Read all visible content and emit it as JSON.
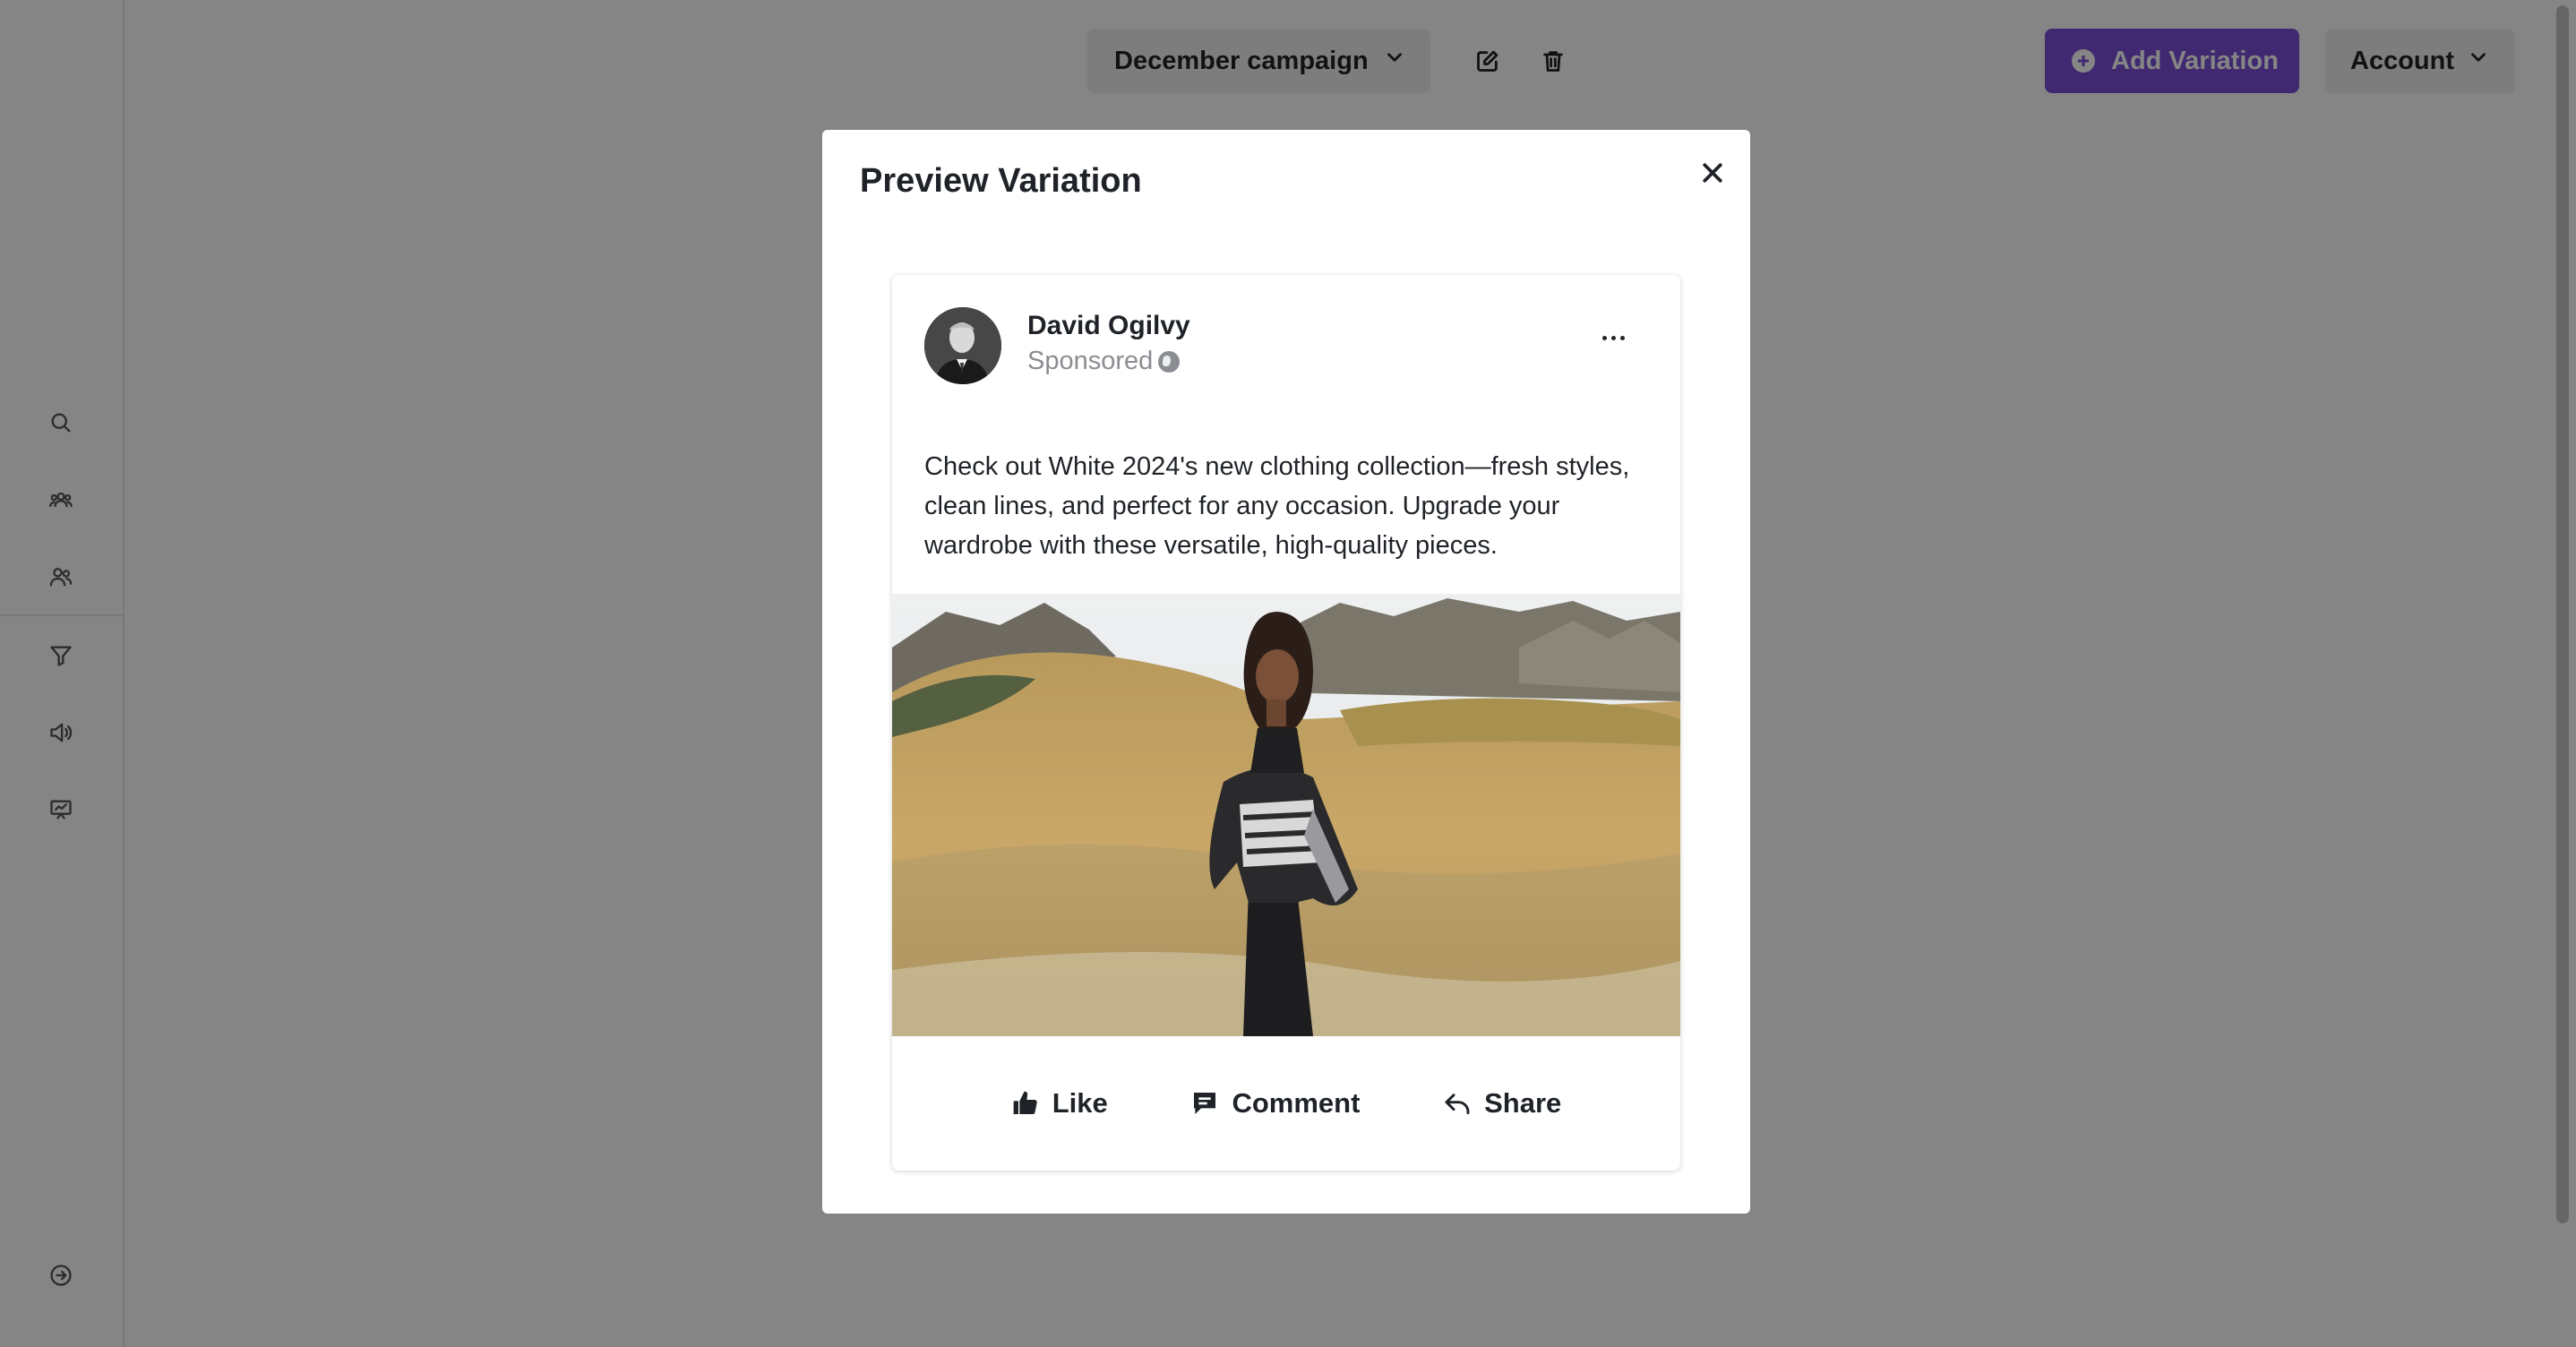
{
  "header": {
    "campaign_select_label": "December campaign",
    "add_variation_label": "Add Variation",
    "account_label": "Account"
  },
  "sidebar": {
    "items": [
      {
        "icon": "search-icon"
      },
      {
        "icon": "audience-icon"
      },
      {
        "icon": "users-icon"
      },
      {
        "icon": "funnel-icon"
      },
      {
        "icon": "megaphone-icon"
      },
      {
        "icon": "presentation-chart-icon"
      }
    ],
    "footer_icon": "logout-icon"
  },
  "modal": {
    "title": "Preview Variation",
    "post": {
      "author": "David Ogilvy",
      "sponsored": "Sponsored",
      "text": "Check out White 2024's new clothing collection—fresh styles, clean lines, and perfect for any occasion. Upgrade your wardrobe with these versatile, high-quality pieces.",
      "actions": {
        "like": "Like",
        "comment": "Comment",
        "share": "Share"
      }
    }
  },
  "colors": {
    "accent": "#7b4fd6",
    "overlay": "rgba(0,0,0,0.48)",
    "muted_text": "#8a8d91"
  }
}
